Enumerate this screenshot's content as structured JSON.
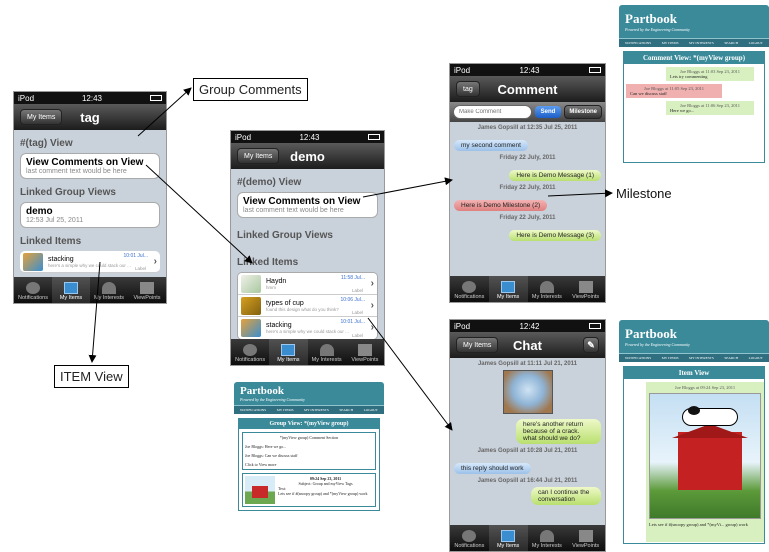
{
  "annotations": {
    "group_comments": "Group Comments",
    "item_view": "ITEM View",
    "milestone": "Milestone"
  },
  "tabs": [
    "Notifications",
    "My Items",
    "My Interests",
    "ViewPoints"
  ],
  "phone_tag": {
    "carrier": "iPod",
    "time": "12:43",
    "nav_button": "My Items",
    "title": "tag",
    "section1": "#(tag) View",
    "cell1_title": "View Comments on View",
    "cell1_sub": "last comment text would be here",
    "section2": "Linked Group Views",
    "cell2_title": "demo",
    "cell2_sub": "12:53 Jul 25, 2011",
    "section3": "Linked Items",
    "item": {
      "name": "stacking",
      "date": "10:01 Jul...",
      "desc": "here's a simple why we could stack our ...",
      "label": "Label"
    }
  },
  "phone_demo": {
    "carrier": "iPod",
    "time": "12:43",
    "nav_button": "My Items",
    "title": "demo",
    "section1": "#(demo) View",
    "cell1_title": "View Comments on View",
    "cell1_sub": "last comment text would be here",
    "section2": "Linked Group Views",
    "section3": "Linked Items",
    "items": [
      {
        "name": "Haydn",
        "date": "11:58 Jul...",
        "desc": "hmm",
        "label": "Label"
      },
      {
        "name": "types of cup",
        "date": "10:06 Jul...",
        "desc": "found this design what do you think?",
        "label": "Label"
      },
      {
        "name": "stacking",
        "date": "10:01 Jul...",
        "desc": "here's a simple why we could stack our ...",
        "label": "Label"
      }
    ]
  },
  "phone_comment": {
    "carrier": "iPod",
    "time": "12:43",
    "nav_button": "tag",
    "title": "Comment",
    "placeholder": "Make Comment",
    "send": "Send",
    "milestone": "Milestone",
    "messages": [
      {
        "header": "James Gopsill at 12:35 Jul 25, 2011",
        "text": "my second comment",
        "style": "blue"
      },
      {
        "header": "Friday 22 July, 2011",
        "text": "Here is Demo Message (1)",
        "style": "green"
      },
      {
        "header": "Friday 22 July, 2011",
        "text": "Here is Demo Milestone (2)",
        "style": "red"
      },
      {
        "header": "Friday 22 July, 2011",
        "text": "Here is Demo Message (3)",
        "style": "green"
      }
    ]
  },
  "phone_chat": {
    "carrier": "iPod",
    "time": "12:42",
    "nav_button": "My Items",
    "title": "Chat",
    "h1": "James Gopsill at 11:11 Jul 21, 2011",
    "msg1": "here's another return because of a crack. what should we do?",
    "h2": "James Gopsill at 10:28 Jul 21, 2011",
    "msg2": "this reply should work",
    "h3": "James Gopsill at 16:44 Jul 21, 2011",
    "msg3": "can I continue the conversation"
  },
  "partbook_common": {
    "brand": "Partbook",
    "tagline": "Powered by the Engineering Community",
    "nav": [
      "NOTIFICATIONS",
      "MY ITEMS",
      "MY INTERESTS",
      "SEARCH",
      "LOGOUT"
    ]
  },
  "pb_group_view": {
    "box_title": "Group View: *(myView group)",
    "section_header": "*(myView group) Comment Section",
    "line1": "Joe Bloggs: Here we go...",
    "line2": "Joe Bloggs: Can we discuss staff",
    "line3": "Click to View more",
    "post_date": "09:24 Sep 23, 2011",
    "post_subject": "Subject: Group and myView Tags",
    "post_text": "Text:\nLets see if #(snoopy group) and *(myView group) work"
  },
  "pb_comment_view": {
    "box_title": "Comment View: *(myView group)",
    "c1_meta": "Joe Bloggs at 11:03 Sep 23, 2011",
    "c1_text": "Lets try commenting",
    "c2_meta": "Joe Bloggs at 11:05 Sep 23, 2011",
    "c2_text": "Can we discuss staff",
    "c3_meta": "Joe Bloggs at 11:06 Sep 23, 2011",
    "c3_text": "Here we go..."
  },
  "pb_item_view": {
    "box_title": "Item View",
    "meta": "Joe Bloggs at 09:24 Sep 23, 2011",
    "text": "Lets see if #(snoopy group) and *(myVi... group) work"
  }
}
